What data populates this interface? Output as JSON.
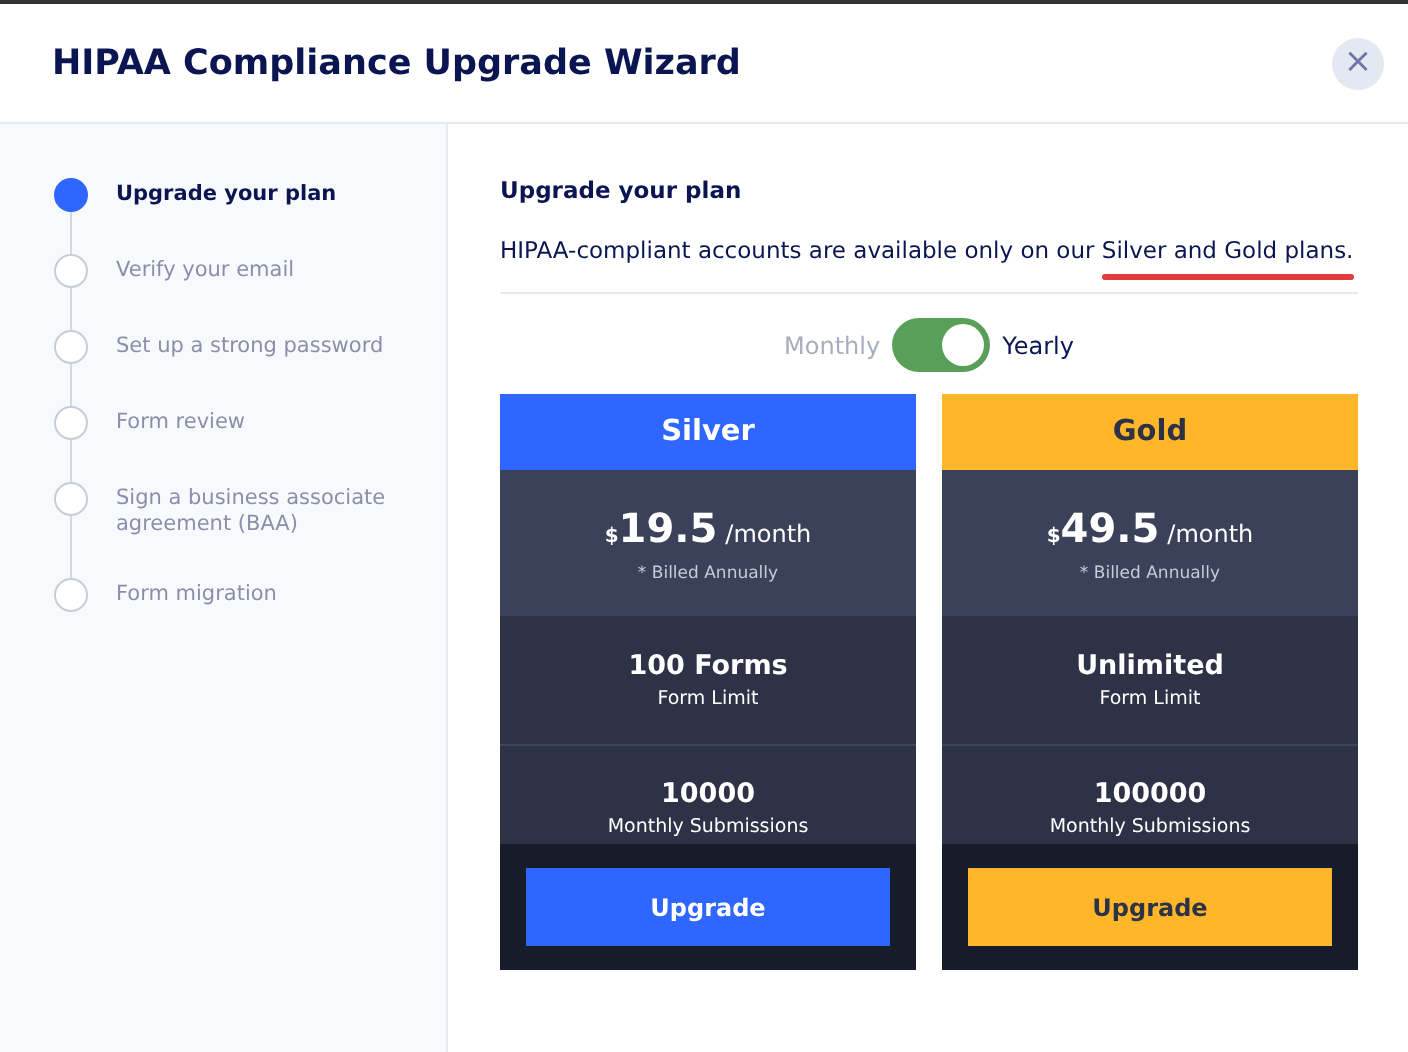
{
  "window": {
    "title": "HIPAA Compliance Upgrade Wizard",
    "close": "×"
  },
  "steps": [
    {
      "label": "Upgrade your plan",
      "selected": true
    },
    {
      "label": "Verify your email",
      "selected": false
    },
    {
      "label": "Set up a strong password",
      "selected": false
    },
    {
      "label": "Form review",
      "selected": false
    },
    {
      "label": "Sign a business associate agreement (BAA)",
      "selected": false
    },
    {
      "label": "Form migration",
      "selected": false
    }
  ],
  "content": {
    "heading": "Upgrade your plan",
    "intro": "HIPAA-compliant accounts are available only on our ",
    "intro_highlight": "Silver and Gold plans."
  },
  "billing": {
    "left_label": "Monthly",
    "right_label": "Yearly",
    "on": true
  },
  "plans": [
    {
      "name": "Silver",
      "color": "#2e66ff",
      "currency": "$",
      "price": "19.5",
      "period": "/month",
      "note": "* Billed Annually",
      "forms": "100 Forms",
      "forms_label": "Form Limit",
      "submissions": "10000",
      "submissions_label": "Monthly Submissions",
      "button": "Upgrade"
    },
    {
      "name": "Gold",
      "color": "#ffb629",
      "currency": "$",
      "price": "49.5",
      "period": "/month",
      "note": "* Billed Annually",
      "forms": "Unlimited",
      "forms_label": "Form Limit",
      "submissions": "100000",
      "submissions_label": "Monthly Submissions",
      "button": "Upgrade"
    }
  ]
}
